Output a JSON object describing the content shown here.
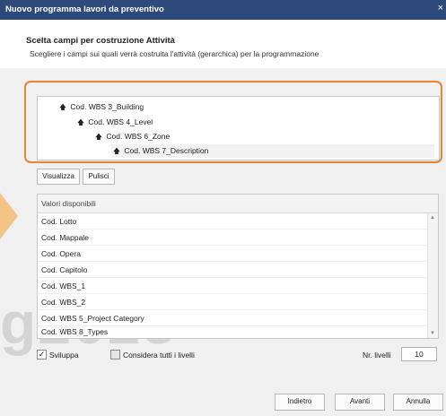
{
  "window": {
    "title": "Nuovo programma lavori da preventivo",
    "close_glyph": "×"
  },
  "header": {
    "heading": "Scelta campi per costruzione Attività",
    "subheading": "Scegliere i campi sui quali verrà costruita l'attività (gerarchica) per la programmazione"
  },
  "tree": {
    "items": [
      {
        "label": "Cod. WBS 3_Building"
      },
      {
        "label": "Cod. WBS 4_Level"
      },
      {
        "label": "Cod. WBS 6_Zone"
      },
      {
        "label": "Cod. WBS 7_Description"
      }
    ],
    "arrow_glyph": "🡅"
  },
  "buttons": {
    "visualizza": "Visualizza",
    "pulisci": "Pulisci",
    "indietro": "Indietro",
    "avanti": "Avanti",
    "annulla": "Annulla"
  },
  "available_list": {
    "header": "Valori disponibili",
    "items": [
      "Cod. Lotto",
      "Cod. Mappale",
      "Cod. Opera",
      "Cod. Capitolo",
      "Cod. WBS_1",
      "Cod. WBS_2",
      "Cod. WBS 5_Project Category",
      "Cod. WBS 8_Types"
    ],
    "scroll_up_glyph": "▲",
    "scroll_down_glyph": "▼"
  },
  "options": {
    "sviluppa_label": "Sviluppa",
    "sviluppa_checked": true,
    "check_glyph": "✓",
    "considera_label": "Considera tutti i livelli",
    "considera_checked": false,
    "nr_livelli_label": "Nr. livelli",
    "nr_livelli_value": "10"
  },
  "watermark": "g2023",
  "colors": {
    "titlebar": "#2e4a7a",
    "highlight": "#e8833a",
    "chevron": "#f3c483"
  }
}
